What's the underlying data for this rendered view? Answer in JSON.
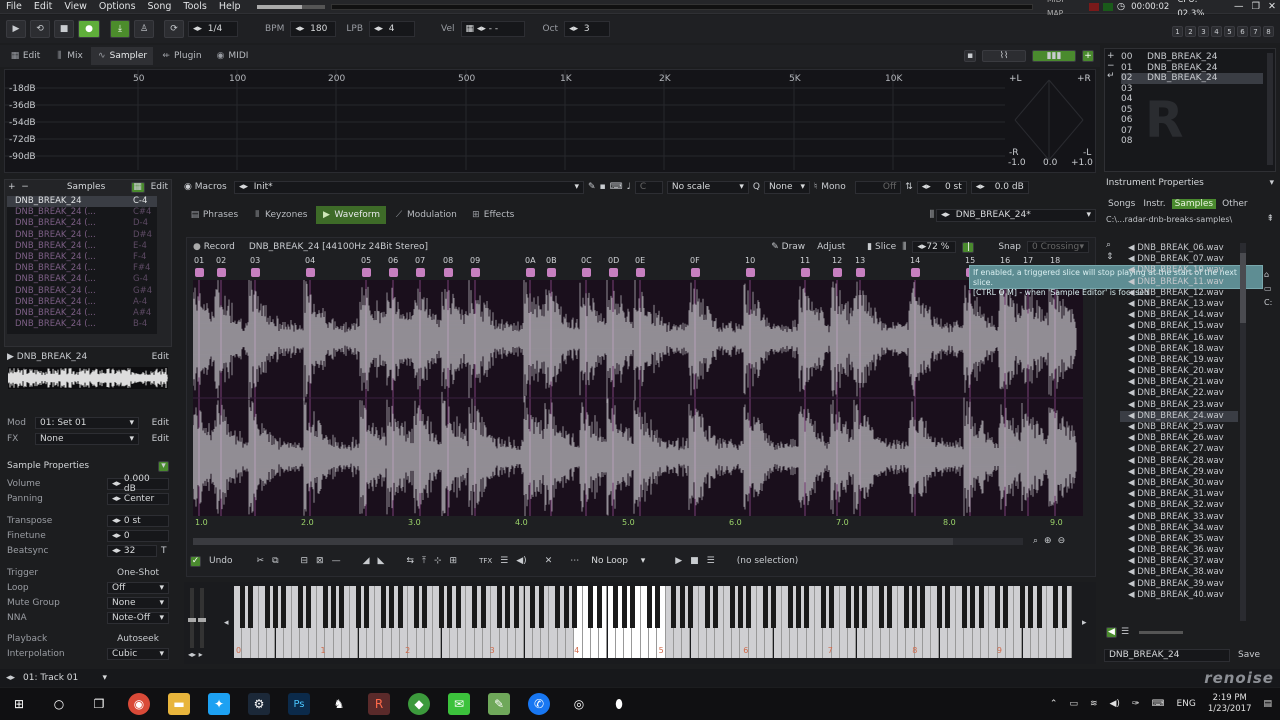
{
  "menu": [
    "File",
    "Edit",
    "View",
    "Options",
    "Song",
    "Tools",
    "Help"
  ],
  "status": {
    "midi_map": "MIDI MAP",
    "time": "00:00:02",
    "cpu": "CPU: 02.3%"
  },
  "track_numbers": [
    "1",
    "2",
    "3",
    "4",
    "5",
    "6",
    "7",
    "8"
  ],
  "transport": {
    "pattern_pos": "1/4",
    "bpm_label": "BPM",
    "bpm": "180",
    "lpb_label": "LPB",
    "lpb": "4",
    "vel_label": "Vel",
    "vel": "- -",
    "oct_label": "Oct",
    "oct": "3"
  },
  "view_tabs": [
    "Edit",
    "Mix",
    "Sampler",
    "Plugin",
    "MIDI"
  ],
  "spectrum": {
    "freqs": [
      "50",
      "100",
      "200",
      "500",
      "1K",
      "2K",
      "5K",
      "10K"
    ],
    "db": [
      "-18dB",
      "-36dB",
      "-54dB",
      "-72dB",
      "-90dB"
    ],
    "scope": {
      "pl": "+L",
      "pr": "+R",
      "ml": "-R",
      "mr": "-L",
      "x1": "-1.0",
      "x2": "0.0",
      "x3": "+1.0"
    }
  },
  "instruments": {
    "slots": [
      "00",
      "01",
      "02",
      "03",
      "04",
      "05",
      "06",
      "07",
      "08"
    ],
    "names": [
      "DNB_BREAK_24",
      "DNB_BREAK_24",
      "DNB_BREAK_24"
    ],
    "properties_label": "Instrument Properties"
  },
  "samples": {
    "header": "Samples",
    "edit": "Edit",
    "items": [
      {
        "name": "DNB_BREAK_24",
        "note": "C-4"
      },
      {
        "name": "DNB_BREAK_24 (...",
        "note": "C#4"
      },
      {
        "name": "DNB_BREAK_24 (...",
        "note": "D-4"
      },
      {
        "name": "DNB_BREAK_24 (...",
        "note": "D#4"
      },
      {
        "name": "DNB_BREAK_24 (...",
        "note": "E-4"
      },
      {
        "name": "DNB_BREAK_24 (...",
        "note": "F-4"
      },
      {
        "name": "DNB_BREAK_24 (...",
        "note": "F#4"
      },
      {
        "name": "DNB_BREAK_24 (...",
        "note": "G-4"
      },
      {
        "name": "DNB_BREAK_24 (...",
        "note": "G#4"
      },
      {
        "name": "DNB_BREAK_24 (...",
        "note": "A-4"
      },
      {
        "name": "DNB_BREAK_24 (...",
        "note": "A#4"
      },
      {
        "name": "DNB_BREAK_24 (...",
        "note": "B-4"
      }
    ],
    "current": "DNB_BREAK_24",
    "mod_label": "Mod",
    "mod_value": "01: Set 01",
    "fx_label": "FX",
    "fx_value": "None"
  },
  "props": {
    "title": "Sample Properties",
    "volume": {
      "label": "Volume",
      "value": "0.000 dB"
    },
    "panning": {
      "label": "Panning",
      "value": "Center"
    },
    "transpose": {
      "label": "Transpose",
      "value": "0 st"
    },
    "finetune": {
      "label": "Finetune",
      "value": "0"
    },
    "beatsync": {
      "label": "Beatsync",
      "value": "32",
      "flag": "T"
    },
    "trigger": {
      "label": "Trigger",
      "value": "One-Shot"
    },
    "loop": {
      "label": "Loop",
      "value": "Off"
    },
    "mute": {
      "label": "Mute Group",
      "value": "None"
    },
    "nna": {
      "label": "NNA",
      "value": "Note-Off"
    },
    "playback": {
      "label": "Playback",
      "value": "Autoseek"
    },
    "interp": {
      "label": "Interpolation",
      "value": "Cubic"
    }
  },
  "toolbar2": {
    "macros": "Macros",
    "preset": "Init*",
    "scale": "No scale",
    "scale_key": "C",
    "none": "None",
    "mono": "Mono",
    "off": "Off",
    "st": "0 st",
    "db": "0.0 dB"
  },
  "editor_tabs": [
    "Phrases",
    "Keyzones",
    "Waveform",
    "Modulation",
    "Effects"
  ],
  "editor_title": "DNB_BREAK_24*",
  "waveform": {
    "record": "Record",
    "info": "DNB_BREAK_24 [44100Hz 24Bit Stereo]",
    "draw": "Draw",
    "adjust": "Adjust",
    "slice": "Slice",
    "zoom": "72 %",
    "snap": "Snap",
    "crossing": "0 Crossing",
    "tooltip1": "If enabled, a triggered slice will stop playing at the start of the next slice.",
    "tooltip2": "[CTRL O M] - when 'Sample Editor' is focused",
    "slices": [
      "01",
      "02",
      "03",
      "04",
      "05",
      "06",
      "07",
      "08",
      "09",
      "0A",
      "0B",
      "0C",
      "0D",
      "0E",
      "0F",
      "10",
      "11",
      "12",
      "13",
      "14",
      "15",
      "16",
      "17",
      "18"
    ],
    "ruler": [
      "1.0",
      "2.0",
      "3.0",
      "4.0",
      "5.0",
      "6.0",
      "7.0",
      "8.0",
      "9.0"
    ],
    "undo": "Undo",
    "loop": "No Loop",
    "selection": "(no selection)"
  },
  "keyboard_octaves": [
    "0",
    "1",
    "2",
    "3",
    "4",
    "5",
    "6",
    "7",
    "8",
    "9"
  ],
  "browser": {
    "tabs": [
      "Songs",
      "Instr.",
      "Samples",
      "Other"
    ],
    "path": "C:\\...radar-dnb-breaks-samples\\",
    "files": [
      "DNB_BREAK_06.wav",
      "DNB_BREAK_07.wav",
      "DNB_BREAK_10.wav",
      "DNB_BREAK_11.wav",
      "DNB_BREAK_12.wav",
      "DNB_BREAK_13.wav",
      "DNB_BREAK_14.wav",
      "DNB_BREAK_15.wav",
      "DNB_BREAK_16.wav",
      "DNB_BREAK_18.wav",
      "DNB_BREAK_19.wav",
      "DNB_BREAK_20.wav",
      "DNB_BREAK_21.wav",
      "DNB_BREAK_22.wav",
      "DNB_BREAK_23.wav",
      "DNB_BREAK_24.wav",
      "DNB_BREAK_25.wav",
      "DNB_BREAK_26.wav",
      "DNB_BREAK_27.wav",
      "DNB_BREAK_28.wav",
      "DNB_BREAK_29.wav",
      "DNB_BREAK_30.wav",
      "DNB_BREAK_31.wav",
      "DNB_BREAK_32.wav",
      "DNB_BREAK_33.wav",
      "DNB_BREAK_34.wav",
      "DNB_BREAK_35.wav",
      "DNB_BREAK_36.wav",
      "DNB_BREAK_37.wav",
      "DNB_BREAK_38.wav",
      "DNB_BREAK_39.wav",
      "DNB_BREAK_40.wav"
    ],
    "selected_index": 15,
    "filename": "DNB_BREAK_24",
    "save": "Save"
  },
  "track_sel": "01: Track 01",
  "logo": "renoise",
  "taskbar": {
    "lang": "ENG",
    "time": "2:19 PM",
    "date": "1/23/2017"
  },
  "colors": {
    "accent": "#9bd36a",
    "slice": "#c77fc0",
    "wave": "#d8d8dc",
    "wave_bg": "#1a0f1c"
  }
}
